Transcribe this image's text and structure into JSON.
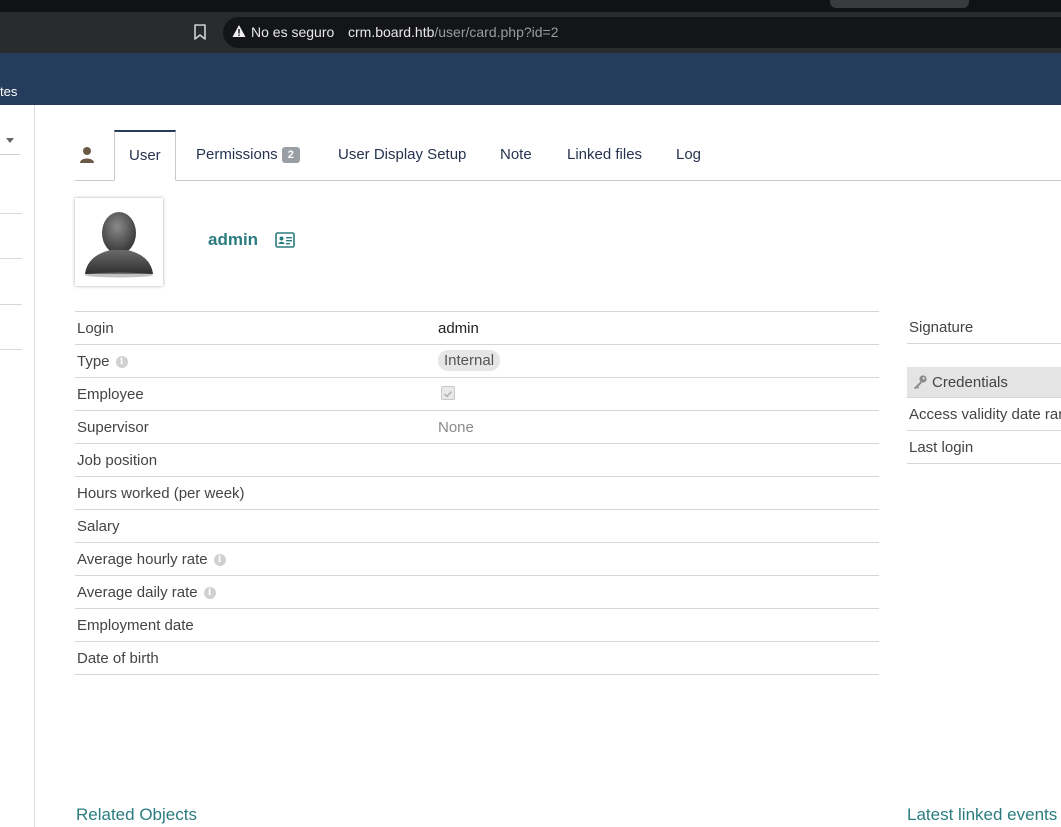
{
  "browser": {
    "security_text": "No es seguro",
    "url_host": "crm.board.htb",
    "url_path": "/user/card.php?id=2"
  },
  "app_header": {
    "menu_fragment": "tes"
  },
  "tabs": [
    {
      "label": "User",
      "active": true
    },
    {
      "label": "Permissions",
      "badge": "2"
    },
    {
      "label": "User Display Setup"
    },
    {
      "label": "Note"
    },
    {
      "label": "Linked files"
    },
    {
      "label": "Log"
    }
  ],
  "user": {
    "name": "admin"
  },
  "fields": [
    {
      "label": "Login",
      "value": "admin"
    },
    {
      "label": "Type",
      "value": "Internal"
    },
    {
      "label": "Employee",
      "checked": true
    },
    {
      "label": "Supervisor",
      "value": "None"
    },
    {
      "label": "Job position",
      "value": ""
    },
    {
      "label": "Hours worked (per week)",
      "value": ""
    },
    {
      "label": "Salary",
      "value": ""
    },
    {
      "label": "Average hourly rate",
      "value": ""
    },
    {
      "label": "Average daily rate",
      "value": ""
    },
    {
      "label": "Employment date",
      "value": ""
    },
    {
      "label": "Date of birth",
      "value": ""
    }
  ],
  "right_panel": {
    "signature_label": "Signature",
    "credentials_label": "Credentials",
    "access_validity_label": "Access validity date ran",
    "last_login_label": "Last login"
  },
  "sections": {
    "related_objects": "Related Objects",
    "latest_linked_events": "Latest linked events"
  },
  "colors": {
    "header_bg": "#263c5c",
    "accent_teal": "#2b7c7f",
    "tab_text": "#26344f"
  }
}
